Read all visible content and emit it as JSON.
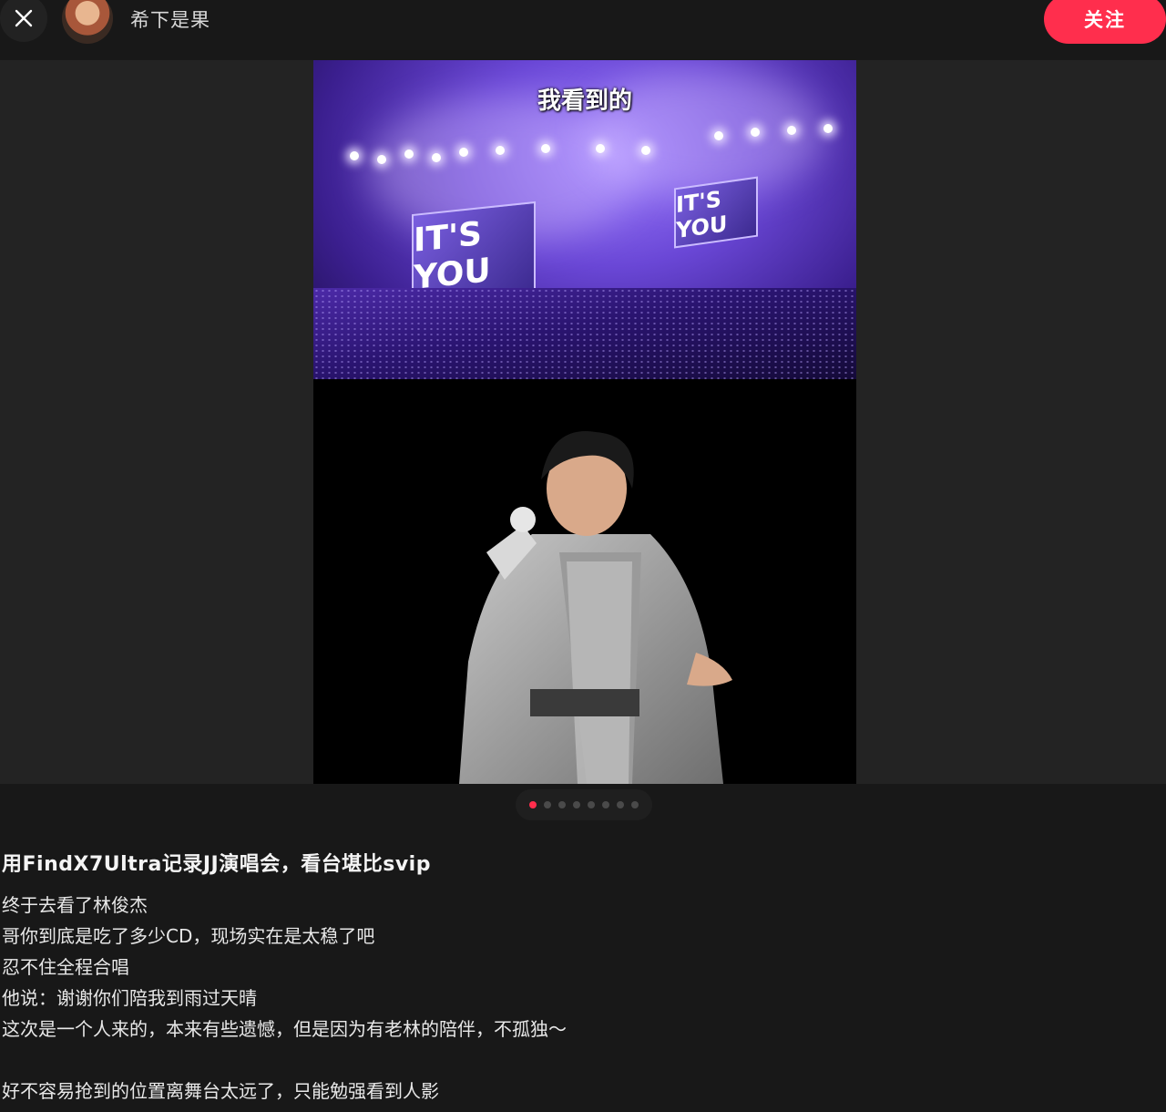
{
  "header": {
    "author_name": "希下是果",
    "follow_label": "关注",
    "close_icon": "close-icon"
  },
  "media": {
    "caption_overlay": "我看到的",
    "screen_text": "IT'S YOU",
    "carousel": {
      "total": 8,
      "current": 1
    }
  },
  "post": {
    "title": "用FindX7Ultra记录JJ演唱会，看台堪比svip",
    "lines": [
      "终于去看了林俊杰",
      "哥你到底是吃了多少CD，现场实在是太稳了吧",
      "忍不住全程合唱",
      "他说：谢谢你们陪我到雨过天晴",
      "这次是一个人来的，本来有些遗憾，但是因为有老林的陪伴，不孤独～",
      "",
      "好不容易抢到的位置离舞台太远了，只能勉强看到人影"
    ]
  },
  "colors": {
    "accent": "#ff2e4d",
    "background": "#181818"
  }
}
